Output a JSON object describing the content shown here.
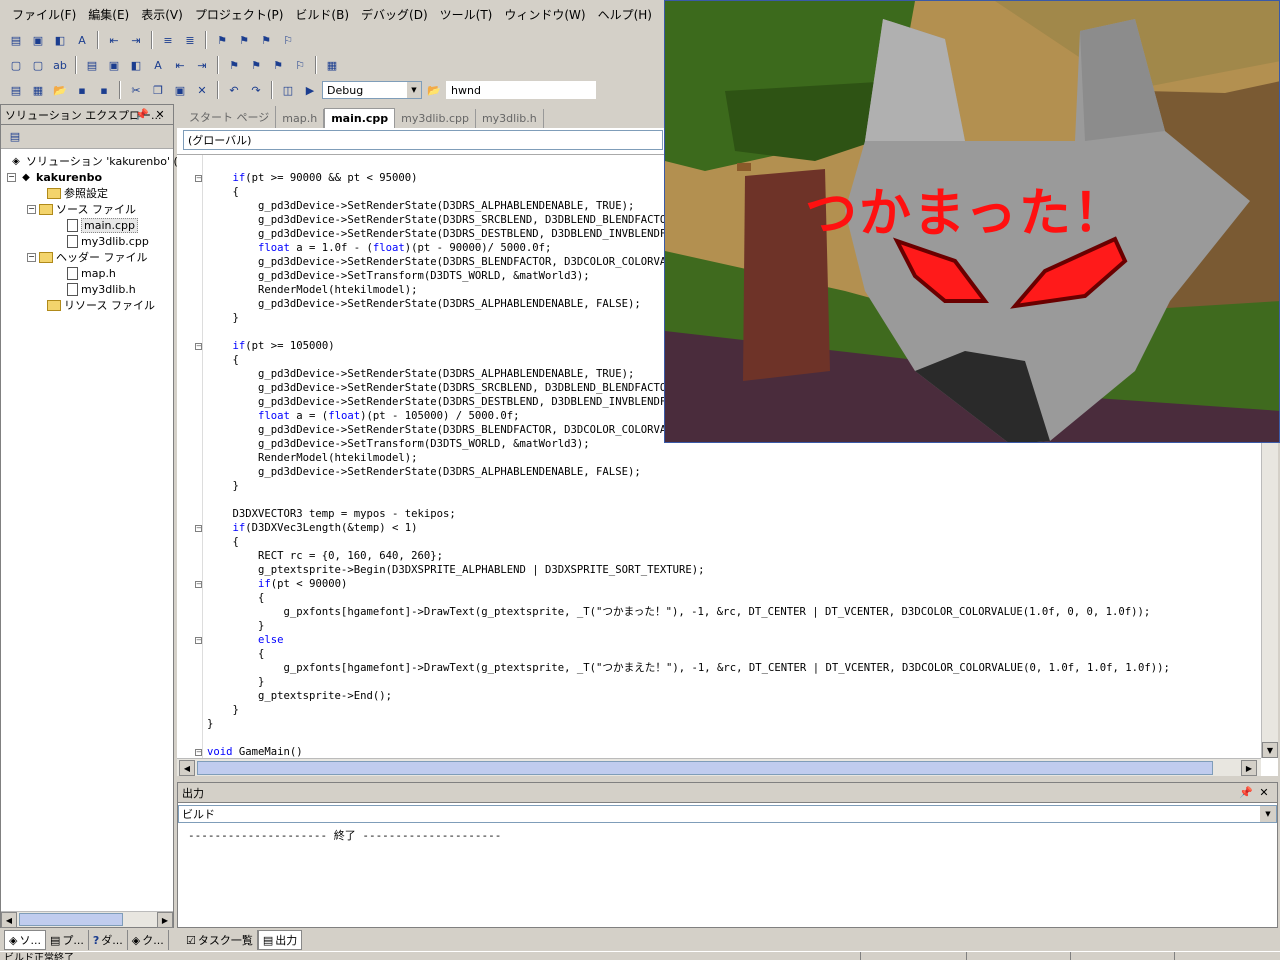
{
  "menu": [
    "ファイル(F)",
    "編集(E)",
    "表示(V)",
    "プロジェクト(P)",
    "ビルド(B)",
    "デバッグ(D)",
    "ツール(T)",
    "ウィンドウ(W)",
    "ヘルプ(H)"
  ],
  "toolbar": {
    "config": "Debug",
    "find_text": "hwnd"
  },
  "solution_explorer": {
    "title": "ソリューション エクスプロー...",
    "root": "ソリューション 'kakurenbo' (1 プ",
    "project": "kakurenbo",
    "references": "参照設定",
    "source_folder": "ソース ファイル",
    "source_files": [
      "main.cpp",
      "my3dlib.cpp"
    ],
    "header_folder": "ヘッダー ファイル",
    "header_files": [
      "map.h",
      "my3dlib.h"
    ],
    "resource_folder": "リソース ファイル"
  },
  "editor": {
    "tabs": [
      "スタート ページ",
      "map.h",
      "main.cpp",
      "my3dlib.cpp",
      "my3dlib.h"
    ],
    "active_tab": "main.cpp",
    "scope": "(グローバル)",
    "code": "    if(pt >= 90000 && pt < 95000)\n    {\n        g_pd3dDevice->SetRenderState(D3DRS_ALPHABLENDENABLE, TRUE);\n        g_pd3dDevice->SetRenderState(D3DRS_SRCBLEND, D3DBLEND_BLENDFACTOR);\n        g_pd3dDevice->SetRenderState(D3DRS_DESTBLEND, D3DBLEND_INVBLENDFACTOR);\n        float a = 1.0f - (float)(pt - 90000)/ 5000.0f;\n        g_pd3dDevice->SetRenderState(D3DRS_BLENDFACTOR, D3DCOLOR_COLORVALUE(a, a, a, a));\n        g_pd3dDevice->SetTransform(D3DTS_WORLD, &matWorld3);\n        RenderModel(htekilmodel);\n        g_pd3dDevice->SetRenderState(D3DRS_ALPHABLENDENABLE, FALSE);\n    }\n\n    if(pt >= 105000)\n    {\n        g_pd3dDevice->SetRenderState(D3DRS_ALPHABLENDENABLE, TRUE);\n        g_pd3dDevice->SetRenderState(D3DRS_SRCBLEND, D3DBLEND_BLENDFACTOR);\n        g_pd3dDevice->SetRenderState(D3DRS_DESTBLEND, D3DBLEND_INVBLENDFACTOR);\n        float a = (float)(pt - 105000) / 5000.0f;\n        g_pd3dDevice->SetRenderState(D3DRS_BLENDFACTOR, D3DCOLOR_COLORVALUE(a, a, a, a));\n        g_pd3dDevice->SetTransform(D3DTS_WORLD, &matWorld3);\n        RenderModel(htekilmodel);\n        g_pd3dDevice->SetRenderState(D3DRS_ALPHABLENDENABLE, FALSE);\n    }\n\n    D3DXVECTOR3 temp = mypos - tekipos;\n    if(D3DXVec3Length(&temp) < 1)\n    {\n        RECT rc = {0, 160, 640, 260};\n        g_ptextsprite->Begin(D3DXSPRITE_ALPHABLEND | D3DXSPRITE_SORT_TEXTURE);\n        if(pt < 90000)\n        {\n            g_pxfonts[hgamefont]->DrawText(g_ptextsprite, _T(\"つかまった！\"), -1, &rc, DT_CENTER | DT_VCENTER, D3DCOLOR_COLORVALUE(1.0f, 0, 0, 1.0f));\n        }\n        else\n        {\n            g_pxfonts[hgamefont]->DrawText(g_ptextsprite, _T(\"つかまえた！\"), -1, &rc, DT_CENTER | DT_VCENTER, D3DCOLOR_COLORVALUE(0, 1.0f, 1.0f, 1.0f));\n        }\n        g_ptextsprite->End();\n    }\n}\n\nvoid GameMain()"
  },
  "output": {
    "title": "出力",
    "source": "ビルド",
    "text": "--------------------- 終了 ---------------------"
  },
  "bottom_tabs_left": [
    "ソ...",
    "プ...",
    "ダ...",
    "ク..."
  ],
  "bottom_tabs_right": [
    "タスク一覧",
    "出力"
  ],
  "status": {
    "left": "ビルド正常終了"
  },
  "game": {
    "message": "つかまった！"
  },
  "colors": {
    "keyword": "#0000ff",
    "game_text": "#ff1010",
    "eyes": "#ff1a1a"
  }
}
